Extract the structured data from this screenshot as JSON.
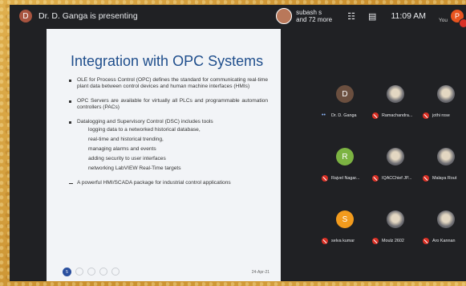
{
  "topbar": {
    "presenter_initial": "D",
    "presenting_label": "Dr. D. Ganga is presenting",
    "viewers_label": "subash s\nand 72 more",
    "layout_icon": "people-layout-icon",
    "chat_icon": "chat-icon",
    "time": "11:09 AM",
    "you_label": "You",
    "you_initial": "P"
  },
  "slide": {
    "title": "Integration with OPC Systems",
    "bullets": [
      "OLE for Process Control (OPC) defines the standard for communicating real-time plant data between control devices and human machine interfaces (HMIs)",
      "OPC Servers are available for virtually all PLCs and programmable automation controllers (PACs)",
      "Datalogging and Supervisory Control (DSC) includes tools",
      "A powerful HMI/SCADA package for industrial control applications"
    ],
    "subitems": [
      "logging data to a networked historical database,",
      "real-time and historical trending,",
      "managing alarms and events",
      "adding security to user interfaces",
      "networking LabVIEW Real-Time targets"
    ],
    "date": "24-Apr-21",
    "page_number": "5"
  },
  "participants": [
    {
      "name": "Dr. D. Ganga",
      "initial": "D",
      "avatar_color": "#6b4f3f",
      "mic": "on"
    },
    {
      "name": "Ramachandra...",
      "initial": "",
      "avatar_color": "#4f7d67",
      "mic": "off"
    },
    {
      "name": "jothi rose",
      "initial": "",
      "avatar_color": "#a04a3a",
      "mic": "off"
    },
    {
      "name": "Rajvel Nagar...",
      "initial": "R",
      "avatar_color": "#7cb342",
      "mic": "off"
    },
    {
      "name": "IQACChief JP...",
      "initial": "",
      "avatar_color": "#5a6a86",
      "mic": "off"
    },
    {
      "name": "Malaya Rout",
      "initial": "",
      "avatar_color": "#5f5f5f",
      "mic": "off"
    },
    {
      "name": "selva kumar",
      "initial": "S",
      "avatar_color": "#f29b1d",
      "mic": "off"
    },
    {
      "name": "Moulz 2602",
      "initial": "",
      "avatar_color": "#8a5a4a",
      "mic": "off"
    },
    {
      "name": "Aro Kannan",
      "initial": "",
      "avatar_color": "#6c5a45",
      "mic": "off"
    }
  ]
}
